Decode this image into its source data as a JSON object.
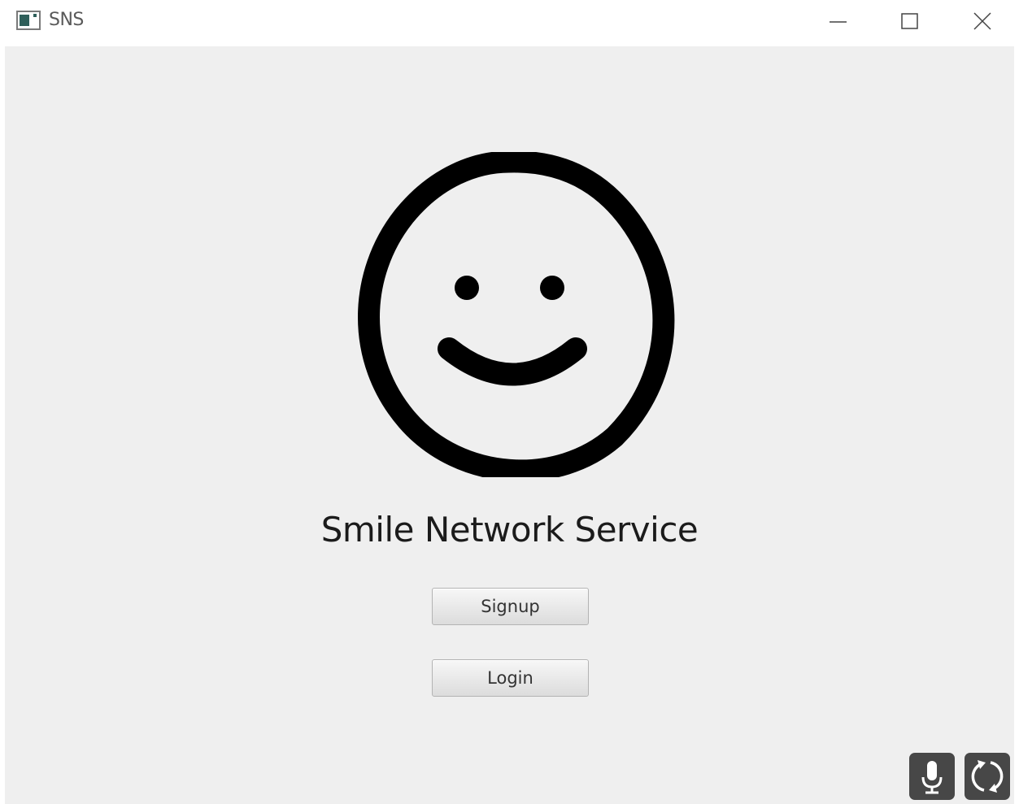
{
  "window": {
    "title": "SNS",
    "icons": [
      "app-window-icon",
      "minimize-icon",
      "maximize-icon",
      "close-icon"
    ]
  },
  "main": {
    "heading": "Smile Network Service",
    "logo_icon": "smiley-face-icon",
    "buttons": {
      "signup_label": "Signup",
      "login_label": "Login"
    }
  },
  "floating_tools": {
    "icons": [
      "microphone-icon",
      "refresh-icon"
    ]
  },
  "colors": {
    "background": "#efefef",
    "text": "#1b1b1b",
    "logo_stroke": "#000000",
    "tool_button": "#474747"
  }
}
